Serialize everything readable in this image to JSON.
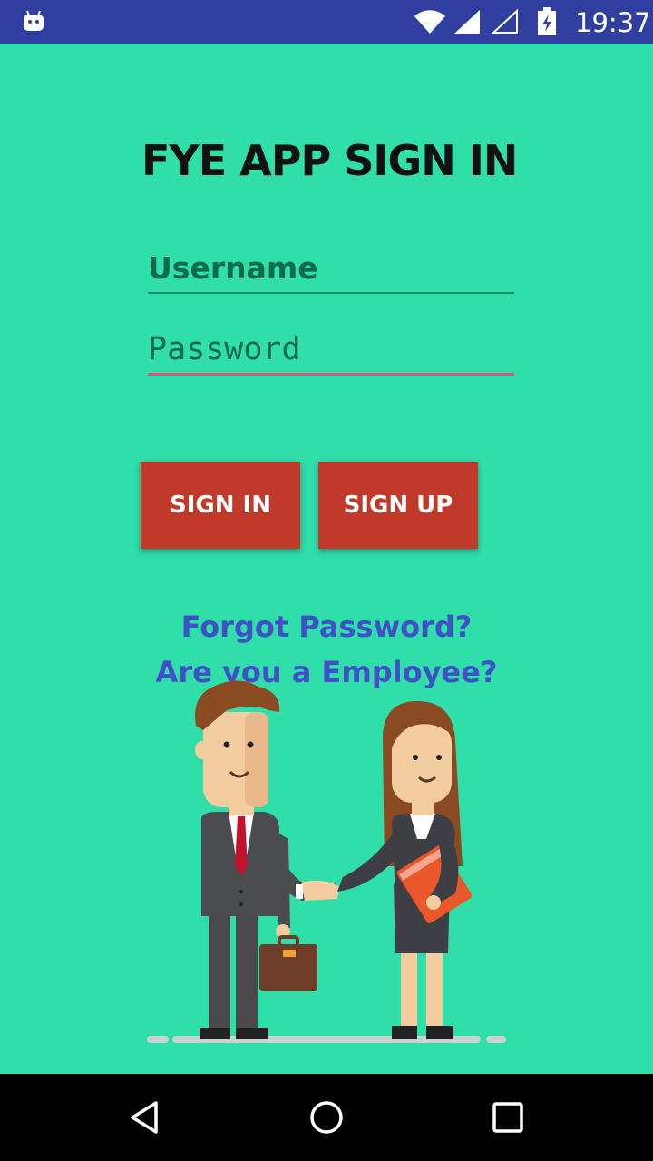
{
  "status_bar": {
    "time": "19:37",
    "icons": [
      "android-icon",
      "wifi-icon",
      "signal-icon",
      "signal-empty-icon",
      "battery-charging-icon"
    ]
  },
  "title": "FYE APP SIGN IN",
  "form": {
    "username_placeholder": "Username",
    "password_placeholder": "Password"
  },
  "buttons": {
    "sign_in": "SIGN IN",
    "sign_up": "SIGN UP"
  },
  "links": {
    "forgot_password": "Forgot Password?",
    "employee": "Are you a Employee?"
  },
  "colors": {
    "background": "#2fdea9",
    "status_bar": "#303f9f",
    "button": "#c0392b",
    "link": "#3f51c5",
    "password_underline": "#e0567a"
  },
  "nav_bar": {
    "icons": [
      "back-icon",
      "home-icon",
      "recents-icon"
    ]
  }
}
